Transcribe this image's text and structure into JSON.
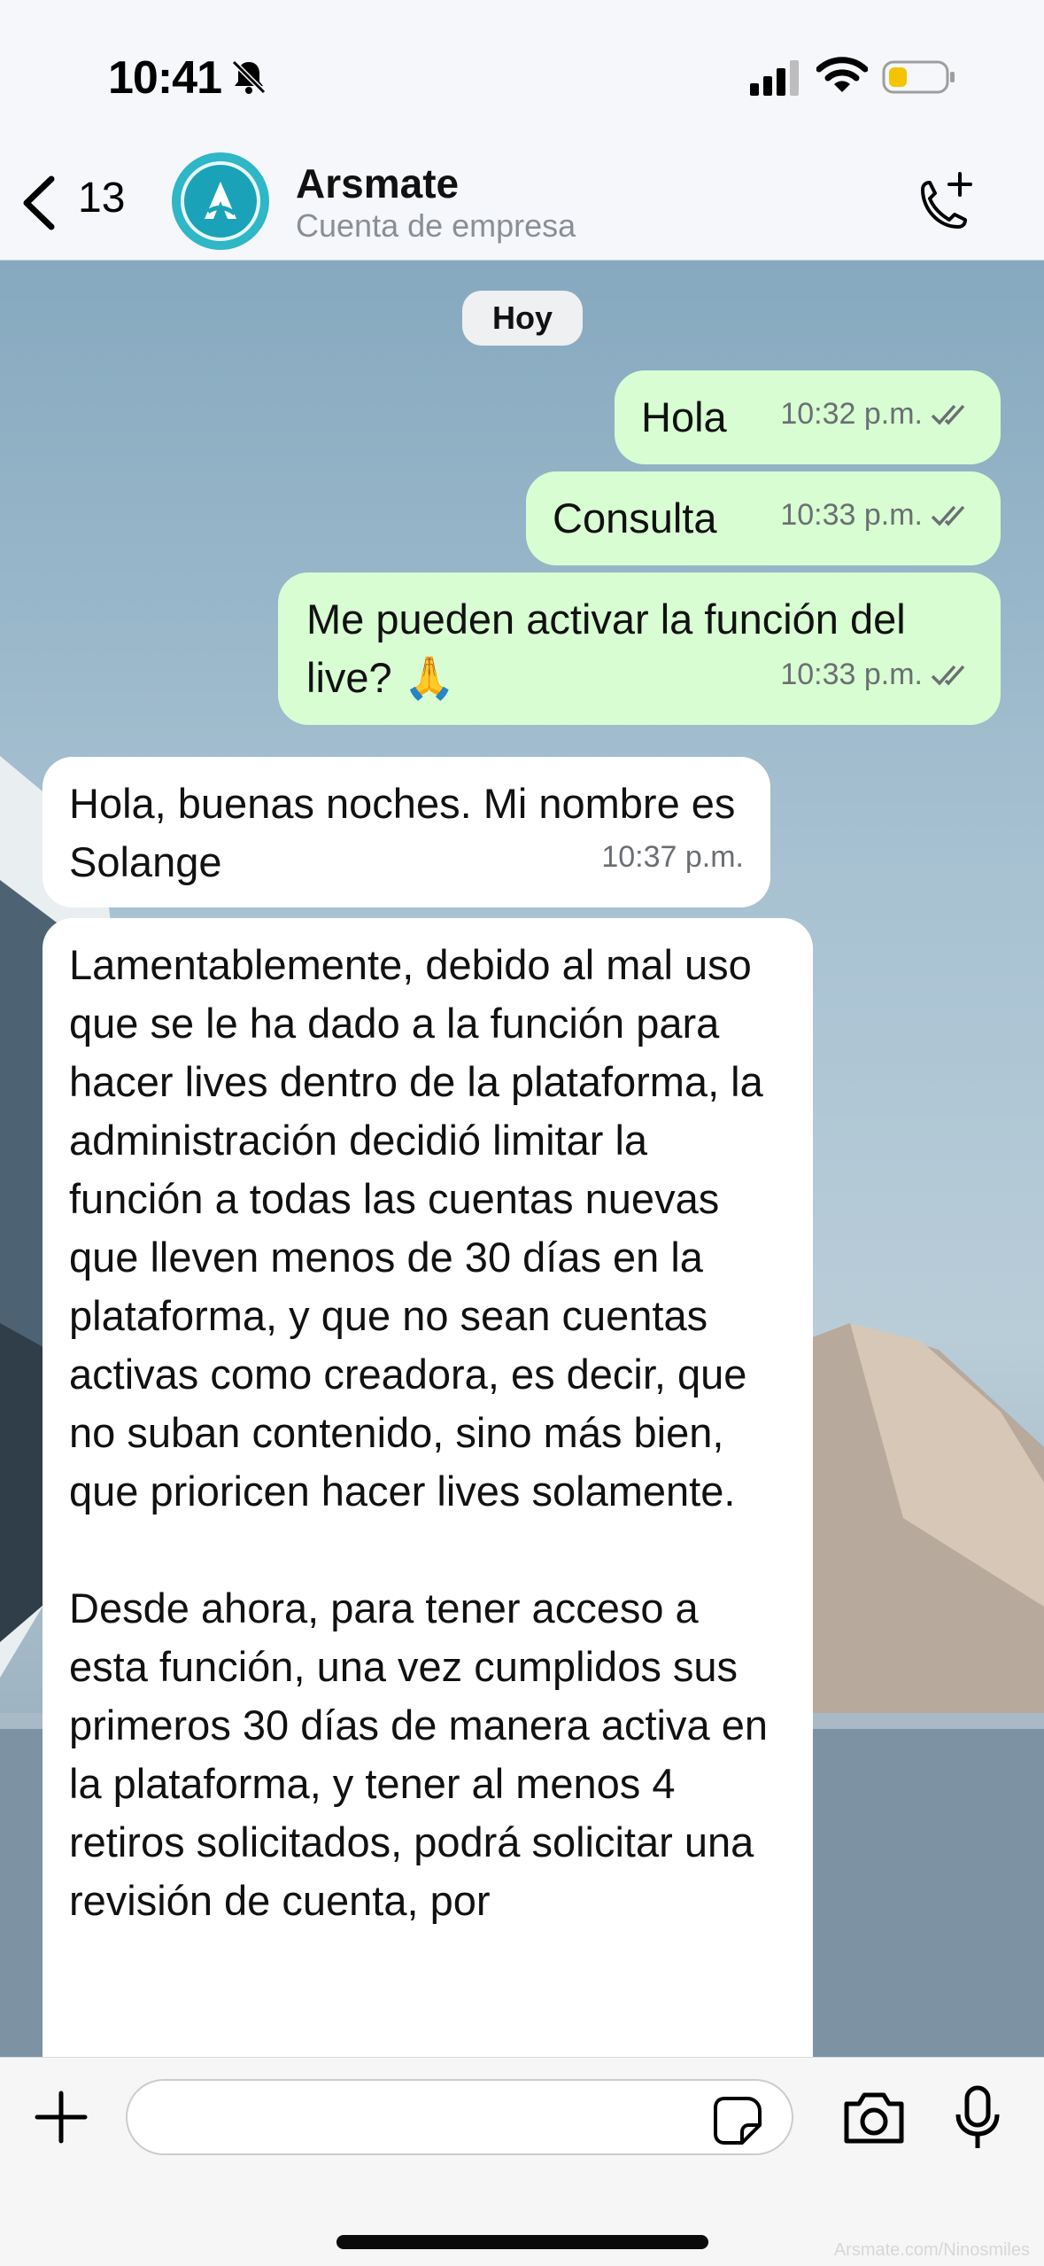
{
  "status_bar": {
    "time": "10:41"
  },
  "header": {
    "back_count": "13",
    "contact_name": "Arsmate",
    "contact_subtitle": "Cuenta de empresa"
  },
  "chat": {
    "date_label": "Hoy",
    "messages": [
      {
        "direction": "outgoing",
        "text": "Hola",
        "time": "10:32 p.m.",
        "status": "read"
      },
      {
        "direction": "outgoing",
        "text": "Consulta",
        "time": "10:33 p.m.",
        "status": "read"
      },
      {
        "direction": "outgoing",
        "text": "Me pueden activar la función del live? 🙏",
        "time": "10:33 p.m.",
        "status": "read"
      },
      {
        "direction": "incoming",
        "text": "Hola, buenas noches. Mi nombre es Solange",
        "time": "10:37 p.m."
      },
      {
        "direction": "incoming",
        "text": "Lamentablemente, debido al mal uso que se le ha dado a la función para hacer lives dentro de la plataforma, la administración decidió limitar la función a todas las cuentas nuevas que lleven menos de 30 días en la plataforma, y que no sean cuentas activas como creadora, es decir, que no suban contenido, sino más bien, que prioricen hacer lives solamente.\n\nDesde ahora, para tener acceso a esta función, una vez cumplidos sus primeros 30 días de manera activa en la plataforma, y tener al menos 4 retiros solicitados, podrá solicitar una revisión de cuenta, por"
      }
    ]
  },
  "composer": {
    "input_value": ""
  },
  "watermark": "Arsmate.com/Ninosmiles",
  "colors": {
    "outgoing_bubble": "#d8fdd2",
    "incoming_bubble": "#ffffff",
    "avatar": "#2fb6c7"
  }
}
